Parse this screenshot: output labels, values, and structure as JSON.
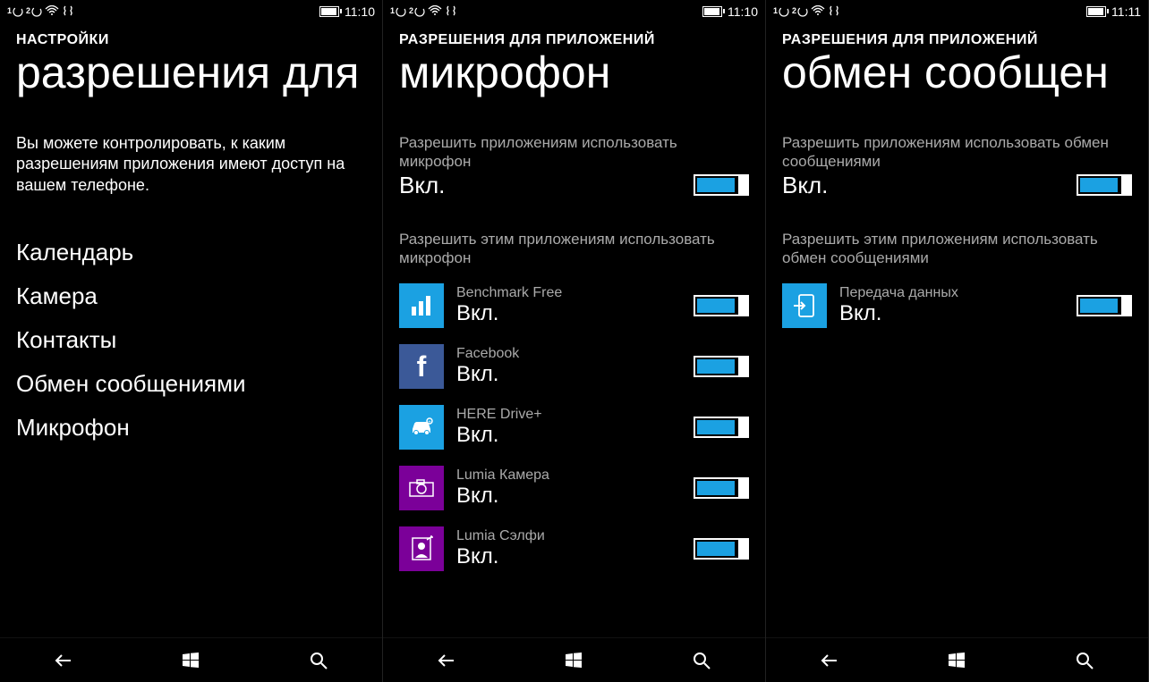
{
  "statusTime1": "11:10",
  "statusTime2": "11:10",
  "statusTime3": "11:11",
  "colors": {
    "accent": "#1BA1E2",
    "facebook": "#3B5998",
    "lumia": "#7B0099"
  },
  "screen1": {
    "breadcrumb": "НАСТРОЙКИ",
    "title": "разрешения для",
    "intro": "Вы можете контролировать, к каким разрешениям приложения имеют доступ на вашем телефоне.",
    "items": [
      "Календарь",
      "Камера",
      "Контакты",
      "Обмен сообщениями",
      "Микрофон"
    ]
  },
  "screen2": {
    "breadcrumb": "РАЗРЕШЕНИЯ ДЛЯ ПРИЛОЖЕНИЙ",
    "title": "микрофон",
    "masterLabel": "Разрешить приложениям использовать микрофон",
    "masterValue": "Вкл.",
    "appsLabel": "Разрешить этим приложениям использовать микрофон",
    "apps": [
      {
        "name": "Benchmark Free",
        "value": "Вкл.",
        "iconBg": "#1BA1E2",
        "icon": "bars"
      },
      {
        "name": "Facebook",
        "value": "Вкл.",
        "iconBg": "#3B5998",
        "icon": "f"
      },
      {
        "name": "HERE Drive+",
        "value": "Вкл.",
        "iconBg": "#1BA1E2",
        "icon": "car"
      },
      {
        "name": "Lumia Камера",
        "value": "Вкл.",
        "iconBg": "#7B0099",
        "icon": "camera"
      },
      {
        "name": "Lumia Сэлфи",
        "value": "Вкл.",
        "iconBg": "#7B0099",
        "icon": "selfie"
      }
    ]
  },
  "screen3": {
    "breadcrumb": "РАЗРЕШЕНИЯ ДЛЯ ПРИЛОЖЕНИЙ",
    "title": "обмен сообщен",
    "masterLabel": "Разрешить приложениям использовать обмен сообщениями",
    "masterValue": "Вкл.",
    "appsLabel": "Разрешить этим приложениям использовать обмен сообщениями",
    "apps": [
      {
        "name": "Передача данных",
        "value": "Вкл.",
        "iconBg": "#1BA1E2",
        "icon": "transfer"
      }
    ]
  }
}
